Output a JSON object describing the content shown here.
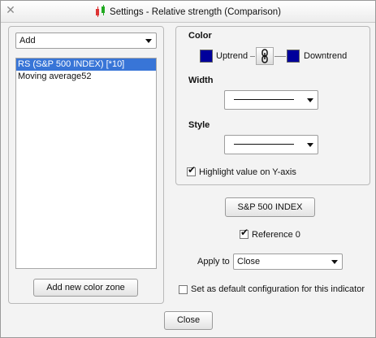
{
  "window": {
    "title": "Settings - Relative strength (Comparison)",
    "close_glyph": "✕"
  },
  "left": {
    "add_combo_value": "Add",
    "items": [
      {
        "label": "RS (S&P 500 INDEX) [*10]",
        "selected": true
      },
      {
        "label": "Moving average52",
        "selected": false
      }
    ],
    "add_color_zone_label": "Add new color zone"
  },
  "right": {
    "color_label": "Color",
    "uptrend_label": "Uptrend",
    "downtrend_label": "Downtrend",
    "uptrend_color": "#00009b",
    "downtrend_color": "#00009b",
    "link_icon": "chain-link-icon",
    "width_label": "Width",
    "style_label": "Style",
    "highlight_label": "Highlight value on Y-axis",
    "highlight_checked": true
  },
  "bottom": {
    "sp500_button_label": "S&P 500 INDEX",
    "reference_label": "Reference 0",
    "reference_checked": true,
    "apply_to_label": "Apply to",
    "apply_to_value": "Close",
    "default_config_label": "Set as default configuration for this indicator",
    "default_config_checked": false,
    "close_button_label": "Close"
  }
}
